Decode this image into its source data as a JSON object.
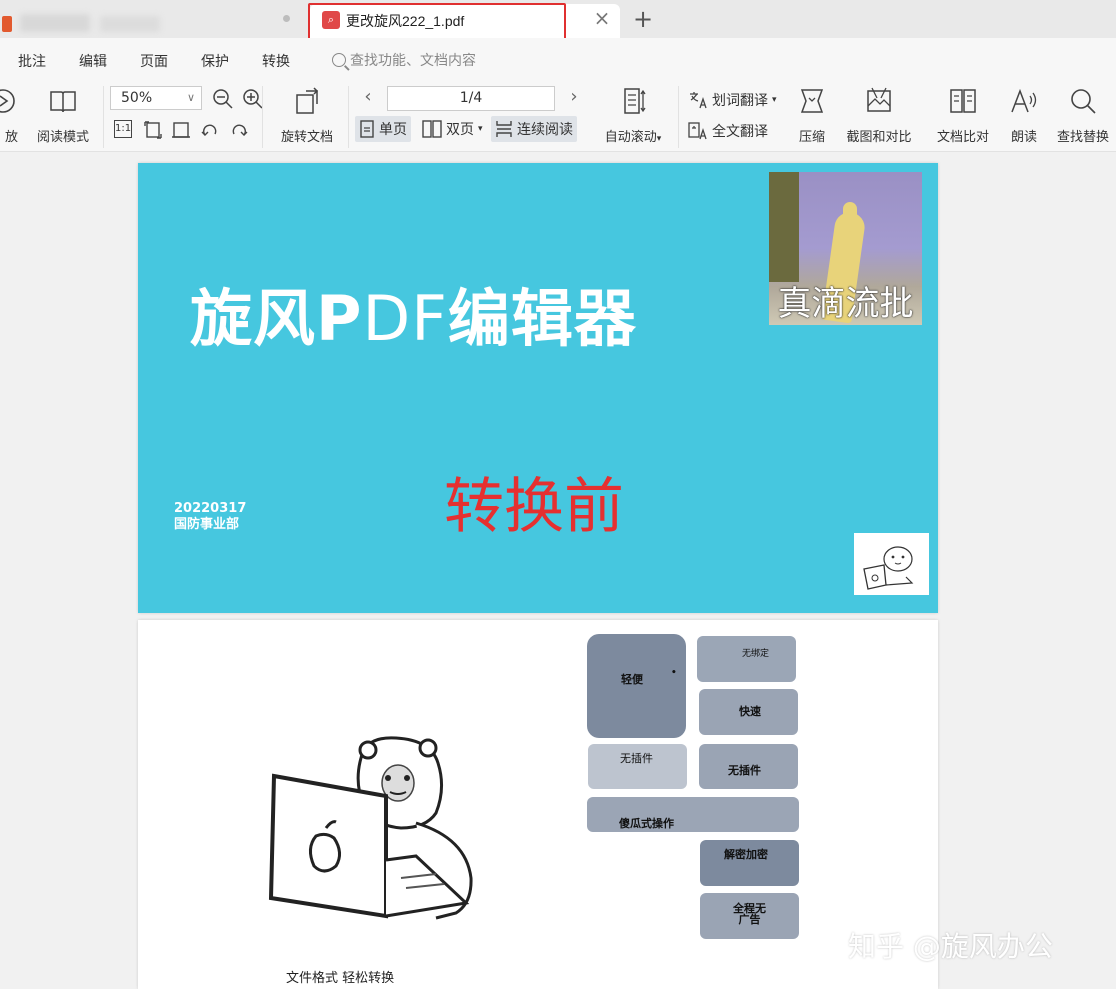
{
  "tab": {
    "title": "更改旋风222_1.pdf",
    "close_glyph": "×",
    "new_glyph": "+"
  },
  "menu": {
    "items": [
      "批注",
      "编辑",
      "页面",
      "保护",
      "转换"
    ],
    "search_placeholder": "查找功能、文档内容"
  },
  "toolbar": {
    "play_label": "放",
    "read_mode_label": "阅读模式",
    "zoom_value": "50%",
    "rotate_doc_label": "旋转文档",
    "page_indicator": "1/4",
    "single_page_label": "单页",
    "double_page_label": "双页",
    "continuous_label": "连续阅读",
    "auto_scroll_label": "自动滚动",
    "word_translate_label": "划词翻译",
    "full_translate_label": "全文翻译",
    "compress_label": "压缩",
    "screenshot_compare_label": "截图和对比",
    "doc_compare_label": "文档比对",
    "read_aloud_label": "朗读",
    "find_replace_label": "查找替换",
    "small_icon_1": "1:1"
  },
  "page1": {
    "title_bold1": "旋风P",
    "title_thin": "DF",
    "title_bold2": "编辑器",
    "before_label": "转换前",
    "date": "20220317",
    "department": "国防事业部",
    "meme_caption": "真滴流批"
  },
  "page2": {
    "caption": "文件格式  轻松转换",
    "tiles": {
      "light": "轻便",
      "unbound": "无绑定",
      "fast": "快速",
      "no_plugin_small": "无插件",
      "no_plugin": "无插件",
      "foolproof": "傻瓜式操作",
      "decrypt": "解密加密",
      "no_ads": "全程无\n广告"
    }
  },
  "watermark": "知乎 @旋风办公",
  "colors": {
    "page1_bg": "#46c7df",
    "before_text": "#e53030",
    "highlight_box": "#e03030",
    "tile": "#9aa3b3"
  }
}
